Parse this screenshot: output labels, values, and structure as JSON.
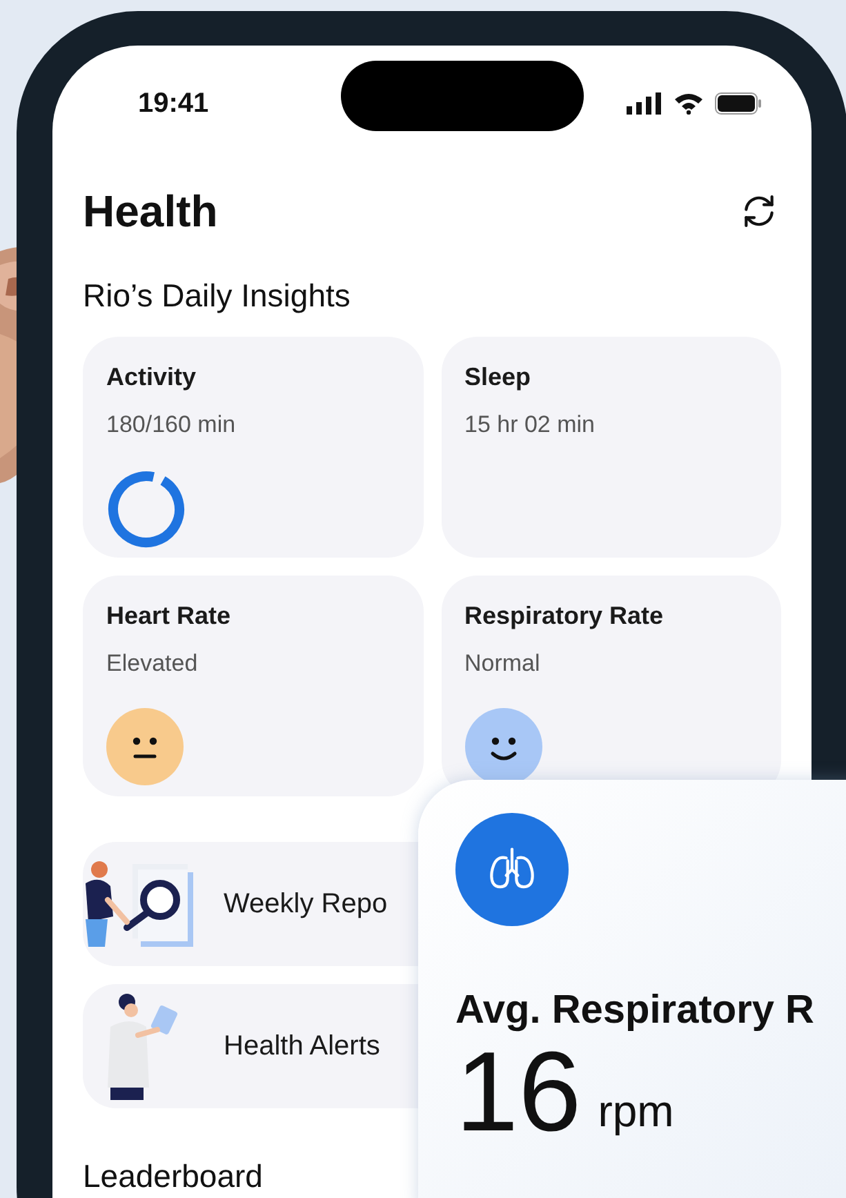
{
  "status_bar": {
    "time": "19:41"
  },
  "header": {
    "title": "Health"
  },
  "section_title": "Rio’s Daily Insights",
  "insights": [
    {
      "title": "Activity",
      "value": "180/160 min",
      "kind": "ring",
      "level": 0.95
    },
    {
      "title": "Sleep",
      "value": "15 hr 02 min",
      "kind": "none"
    },
    {
      "title": "Heart Rate",
      "value": "Elevated",
      "kind": "neutral_face",
      "color": "#f8ca8c"
    },
    {
      "title": "Respiratory Rate",
      "value": "Normal",
      "kind": "happy_face",
      "color": "#a8c7f6"
    }
  ],
  "links": [
    {
      "label": "Weekly Repo",
      "kind": "report"
    },
    {
      "label": "Health Alerts",
      "kind": "alerts"
    }
  ],
  "leaderboard_title": "Leaderboard",
  "overlay_card": {
    "title": "Avg. Respiratory R",
    "value": "16",
    "unit": "rpm"
  }
}
